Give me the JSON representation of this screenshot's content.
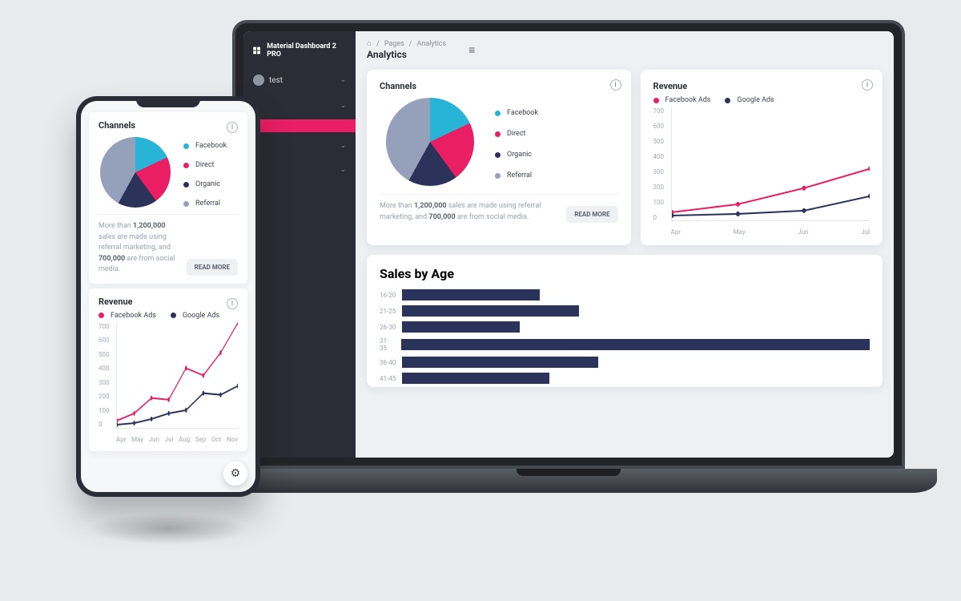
{
  "app": {
    "name": "Material Dashboard 2 PRO"
  },
  "sidebar": {
    "user_label": "test"
  },
  "breadcrumb": {
    "root": "Pages",
    "current": "Analytics"
  },
  "page": {
    "title": "Analytics"
  },
  "channels_card": {
    "title": "Channels",
    "legend": [
      "Facebook",
      "Direct",
      "Organic",
      "Referral"
    ],
    "colors": [
      "#27b4d6",
      "#e91e63",
      "#2b335b",
      "#95a0bb"
    ],
    "footer_prefix": "More than ",
    "footer_b1": "1,200,000",
    "footer_mid": " sales are made using referral marketing, and ",
    "footer_b2": "700,000",
    "footer_suffix": " are from social media.",
    "read_more": "READ MORE"
  },
  "revenue_card": {
    "title": "Revenue",
    "series": [
      {
        "name": "Facebook Ads",
        "color": "#e91e63"
      },
      {
        "name": "Google Ads",
        "color": "#2b335b"
      }
    ]
  },
  "sales_card": {
    "title": "Sales by Age"
  },
  "chart_data": [
    {
      "id": "channels_pie",
      "type": "pie",
      "title": "Channels",
      "series": [
        {
          "name": "Facebook",
          "value": 18,
          "color": "#27b4d6"
        },
        {
          "name": "Direct",
          "value": 22,
          "color": "#e91e63"
        },
        {
          "name": "Organic",
          "value": 18,
          "color": "#2b335b"
        },
        {
          "name": "Referral",
          "value": 42,
          "color": "#95a0bb"
        }
      ]
    },
    {
      "id": "revenue_line_laptop",
      "type": "line",
      "title": "Revenue",
      "xlabel": "",
      "ylabel": "",
      "ylim": [
        0,
        700
      ],
      "yticks": [
        0,
        100,
        200,
        300,
        400,
        500,
        600,
        700
      ],
      "categories": [
        "Apr",
        "May",
        "Jun",
        "Jul"
      ],
      "series": [
        {
          "name": "Facebook Ads",
          "color": "#e91e63",
          "values": [
            50,
            100,
            200,
            320
          ]
        },
        {
          "name": "Google Ads",
          "color": "#2b335b",
          "values": [
            30,
            40,
            60,
            150
          ]
        }
      ]
    },
    {
      "id": "revenue_line_phone",
      "type": "line",
      "title": "Revenue",
      "ylim": [
        0,
        700
      ],
      "yticks": [
        0,
        100,
        200,
        300,
        400,
        500,
        600,
        700
      ],
      "categories": [
        "Apr",
        "May",
        "Jun",
        "Jul",
        "Aug",
        "Sep",
        "Oct",
        "Nov"
      ],
      "series": [
        {
          "name": "Facebook Ads",
          "color": "#e91e63",
          "values": [
            50,
            100,
            200,
            190,
            400,
            350,
            500,
            700
          ]
        },
        {
          "name": "Google Ads",
          "color": "#2b335b",
          "values": [
            20,
            30,
            60,
            100,
            120,
            230,
            220,
            280
          ]
        }
      ]
    },
    {
      "id": "sales_by_age",
      "type": "bar",
      "orientation": "horizontal",
      "title": "Sales by Age",
      "categories": [
        "16-20",
        "21-25",
        "26-30",
        "31-35",
        "36-40",
        "41-45"
      ],
      "values": [
        28,
        36,
        24,
        100,
        40,
        30
      ],
      "xlim": [
        0,
        100
      ],
      "color": "#2b335b"
    }
  ]
}
